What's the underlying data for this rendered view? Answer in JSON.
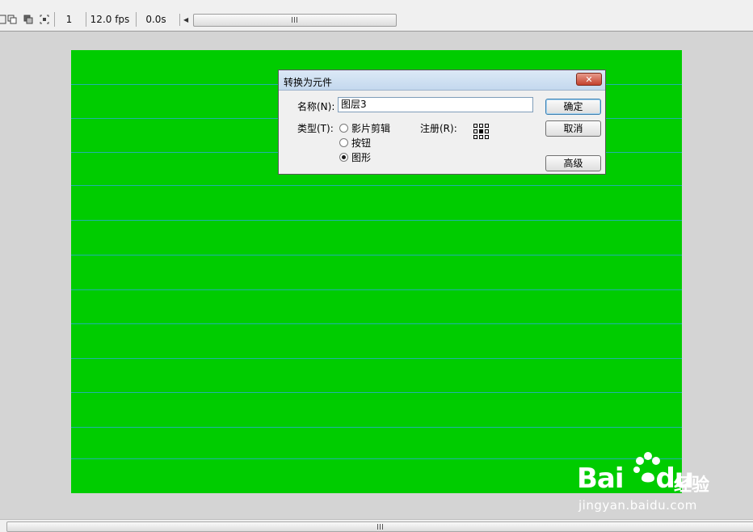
{
  "toolbar": {
    "icons": [
      "center-frame-icon",
      "onion-skin-icon",
      "onion-outline-icon",
      "edit-multiple-frames-icon"
    ],
    "frame": "1",
    "fps": "12.0 fps",
    "elapsed": "0.0s"
  },
  "stage": {
    "color": "#00cc00",
    "guide_color": "#20b2aa"
  },
  "dialog": {
    "title": "转换为元件",
    "name_label": "名称(N):",
    "name_value": "图层3",
    "type_label": "类型(T):",
    "type_options": [
      {
        "label": "影片剪辑",
        "checked": false
      },
      {
        "label": "按钮",
        "checked": false
      },
      {
        "label": "图形",
        "checked": true
      }
    ],
    "registration_label": "注册(R):",
    "buttons": {
      "ok": "确定",
      "cancel": "取消",
      "advanced": "高级"
    }
  },
  "watermark": {
    "brand": "Bai",
    "brand_end": "du",
    "cn": "经验",
    "url": "jingyan.baidu.com"
  }
}
